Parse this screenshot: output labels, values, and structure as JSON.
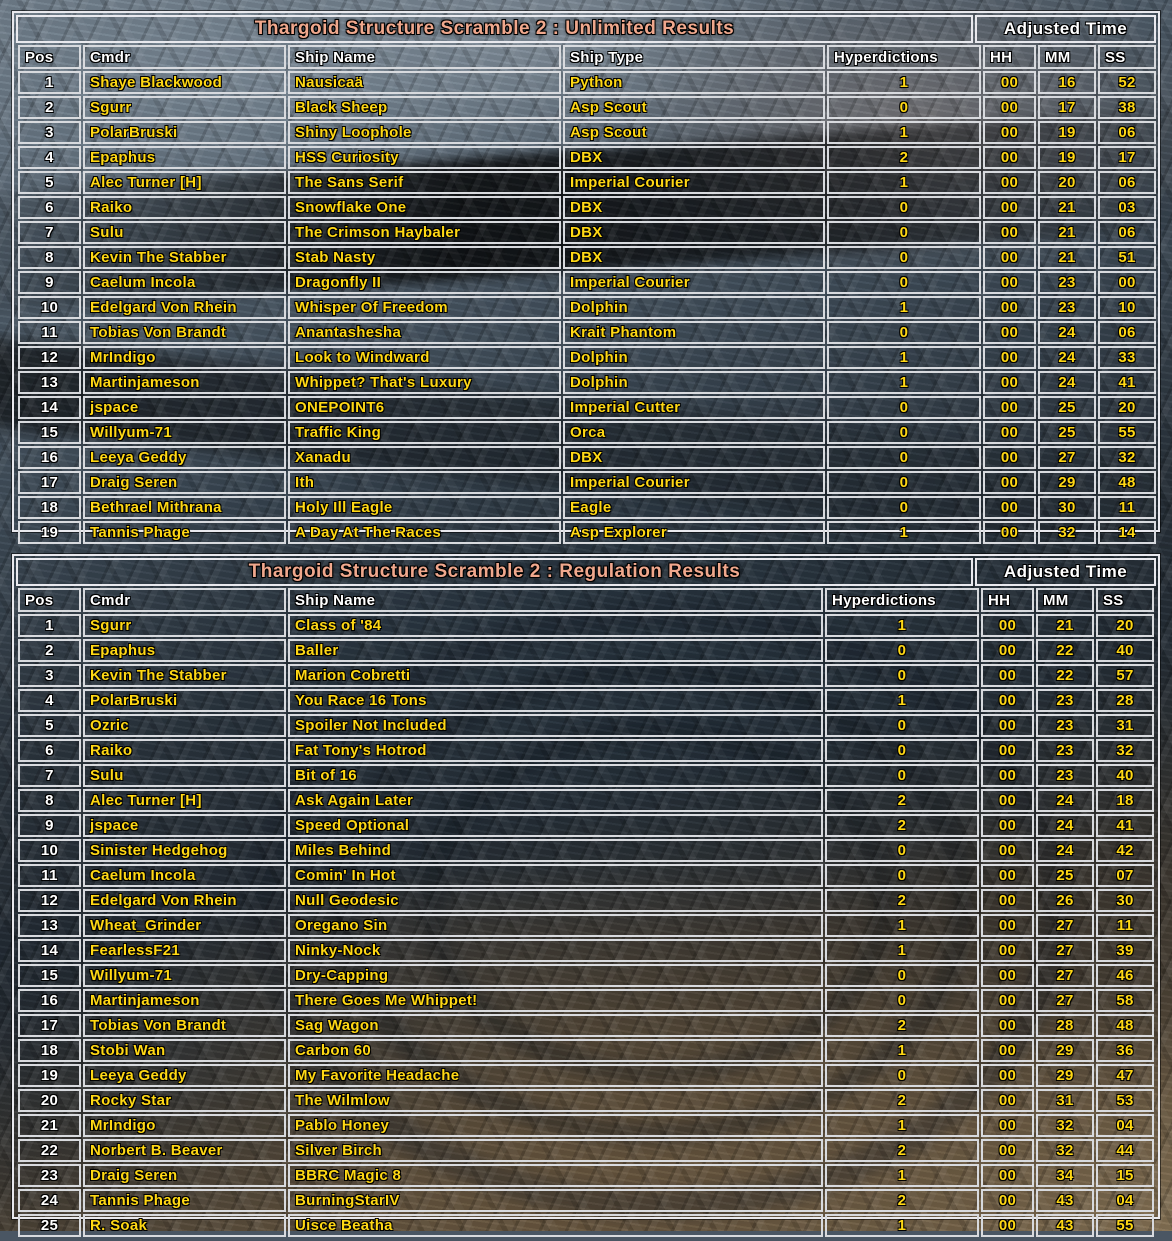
{
  "theme": {
    "title_color": "#f0a88d",
    "header_color": "#ffffff",
    "value_color": "#ffd814",
    "border_color": "#e9e9ee"
  },
  "tables": [
    {
      "id": "unlimited",
      "title": "Thargoid Structure Scramble 2 : Unlimited Results",
      "time_group_label": "Adjusted Time",
      "columns": {
        "pos": "Pos",
        "cmdr": "Cmdr",
        "ship_name": "Ship Name",
        "ship_type": "Ship Type",
        "hyperdictions": "Hyperdictions",
        "hh": "HH",
        "mm": "MM",
        "ss": "SS"
      },
      "has_ship_type": true,
      "rows": [
        {
          "pos": "1",
          "cmdr": "Shaye Blackwood",
          "ship_name": "Nausicaä",
          "ship_type": "Python",
          "hyperdictions": "1",
          "hh": "00",
          "mm": "16",
          "ss": "52"
        },
        {
          "pos": "2",
          "cmdr": "Sgurr",
          "ship_name": "Black Sheep",
          "ship_type": "Asp Scout",
          "hyperdictions": "0",
          "hh": "00",
          "mm": "17",
          "ss": "38"
        },
        {
          "pos": "3",
          "cmdr": "PolarBruski",
          "ship_name": "Shiny Loophole",
          "ship_type": "Asp Scout",
          "hyperdictions": "1",
          "hh": "00",
          "mm": "19",
          "ss": "06"
        },
        {
          "pos": "4",
          "cmdr": "Epaphus",
          "ship_name": "HSS Curiosity",
          "ship_type": "DBX",
          "hyperdictions": "2",
          "hh": "00",
          "mm": "19",
          "ss": "17"
        },
        {
          "pos": "5",
          "cmdr": "Alec Turner [H]",
          "ship_name": "The Sans Serif",
          "ship_type": "Imperial Courier",
          "hyperdictions": "1",
          "hh": "00",
          "mm": "20",
          "ss": "06"
        },
        {
          "pos": "6",
          "cmdr": "Raiko",
          "ship_name": "Snowflake One",
          "ship_type": "DBX",
          "hyperdictions": "0",
          "hh": "00",
          "mm": "21",
          "ss": "03"
        },
        {
          "pos": "7",
          "cmdr": "Sulu",
          "ship_name": "The Crimson Haybaler",
          "ship_type": "DBX",
          "hyperdictions": "0",
          "hh": "00",
          "mm": "21",
          "ss": "06"
        },
        {
          "pos": "8",
          "cmdr": "Kevin The Stabber",
          "ship_name": "Stab Nasty",
          "ship_type": "DBX",
          "hyperdictions": "0",
          "hh": "00",
          "mm": "21",
          "ss": "51"
        },
        {
          "pos": "9",
          "cmdr": "Caelum Incola",
          "ship_name": "Dragonfly II",
          "ship_type": "Imperial Courier",
          "hyperdictions": "0",
          "hh": "00",
          "mm": "23",
          "ss": "00"
        },
        {
          "pos": "10",
          "cmdr": "Edelgard Von Rhein",
          "ship_name": "Whisper Of Freedom",
          "ship_type": "Dolphin",
          "hyperdictions": "1",
          "hh": "00",
          "mm": "23",
          "ss": "10"
        },
        {
          "pos": "11",
          "cmdr": "Tobias Von Brandt",
          "ship_name": "Anantashesha",
          "ship_type": "Krait Phantom",
          "hyperdictions": "0",
          "hh": "00",
          "mm": "24",
          "ss": "06"
        },
        {
          "pos": "12",
          "cmdr": "MrIndigo",
          "ship_name": "Look to Windward",
          "ship_type": "Dolphin",
          "hyperdictions": "1",
          "hh": "00",
          "mm": "24",
          "ss": "33"
        },
        {
          "pos": "13",
          "cmdr": "Martinjameson",
          "ship_name": "Whippet? That's Luxury",
          "ship_type": "Dolphin",
          "hyperdictions": "1",
          "hh": "00",
          "mm": "24",
          "ss": "41"
        },
        {
          "pos": "14",
          "cmdr": "jspace",
          "ship_name": "ONEPOINT6",
          "ship_type": "Imperial Cutter",
          "hyperdictions": "0",
          "hh": "00",
          "mm": "25",
          "ss": "20"
        },
        {
          "pos": "15",
          "cmdr": "Willyum-71",
          "ship_name": "Traffic King",
          "ship_type": "Orca",
          "hyperdictions": "0",
          "hh": "00",
          "mm": "25",
          "ss": "55"
        },
        {
          "pos": "16",
          "cmdr": "Leeya Geddy",
          "ship_name": "Xanadu",
          "ship_type": "DBX",
          "hyperdictions": "0",
          "hh": "00",
          "mm": "27",
          "ss": "32"
        },
        {
          "pos": "17",
          "cmdr": "Draig Seren",
          "ship_name": "Ith",
          "ship_type": "Imperial Courier",
          "hyperdictions": "0",
          "hh": "00",
          "mm": "29",
          "ss": "48"
        },
        {
          "pos": "18",
          "cmdr": "Bethrael Mithrana",
          "ship_name": "Holy Ill Eagle",
          "ship_type": "Eagle",
          "hyperdictions": "0",
          "hh": "00",
          "mm": "30",
          "ss": "11"
        },
        {
          "pos": "19",
          "cmdr": "Tannis Phage",
          "ship_name": "A Day At The Races",
          "ship_type": "Asp Explorer",
          "hyperdictions": "1",
          "hh": "00",
          "mm": "32",
          "ss": "14"
        }
      ]
    },
    {
      "id": "regulation",
      "title": "Thargoid Structure Scramble 2 : Regulation Results",
      "time_group_label": "Adjusted Time",
      "columns": {
        "pos": "Pos",
        "cmdr": "Cmdr",
        "ship_name": "Ship Name",
        "hyperdictions": "Hyperdictions",
        "hh": "HH",
        "mm": "MM",
        "ss": "SS"
      },
      "has_ship_type": false,
      "rows": [
        {
          "pos": "1",
          "cmdr": "Sgurr",
          "ship_name": "Class of '84",
          "hyperdictions": "1",
          "hh": "00",
          "mm": "21",
          "ss": "20"
        },
        {
          "pos": "2",
          "cmdr": "Epaphus",
          "ship_name": "Baller",
          "hyperdictions": "0",
          "hh": "00",
          "mm": "22",
          "ss": "40"
        },
        {
          "pos": "3",
          "cmdr": "Kevin The Stabber",
          "ship_name": "Marion Cobretti",
          "hyperdictions": "0",
          "hh": "00",
          "mm": "22",
          "ss": "57"
        },
        {
          "pos": "4",
          "cmdr": "PolarBruski",
          "ship_name": "You Race 16 Tons",
          "hyperdictions": "1",
          "hh": "00",
          "mm": "23",
          "ss": "28"
        },
        {
          "pos": "5",
          "cmdr": "Ozric",
          "ship_name": "Spoiler Not Included",
          "hyperdictions": "0",
          "hh": "00",
          "mm": "23",
          "ss": "31"
        },
        {
          "pos": "6",
          "cmdr": "Raiko",
          "ship_name": "Fat Tony's Hotrod",
          "hyperdictions": "0",
          "hh": "00",
          "mm": "23",
          "ss": "32"
        },
        {
          "pos": "7",
          "cmdr": "Sulu",
          "ship_name": "Bit of 16",
          "hyperdictions": "0",
          "hh": "00",
          "mm": "23",
          "ss": "40"
        },
        {
          "pos": "8",
          "cmdr": "Alec Turner [H]",
          "ship_name": "Ask Again Later",
          "hyperdictions": "2",
          "hh": "00",
          "mm": "24",
          "ss": "18"
        },
        {
          "pos": "9",
          "cmdr": "jspace",
          "ship_name": "Speed Optional",
          "hyperdictions": "2",
          "hh": "00",
          "mm": "24",
          "ss": "41"
        },
        {
          "pos": "10",
          "cmdr": "Sinister Hedgehog",
          "ship_name": "Miles Behind",
          "hyperdictions": "0",
          "hh": "00",
          "mm": "24",
          "ss": "42"
        },
        {
          "pos": "11",
          "cmdr": "Caelum Incola",
          "ship_name": "Comin' In Hot",
          "hyperdictions": "0",
          "hh": "00",
          "mm": "25",
          "ss": "07"
        },
        {
          "pos": "12",
          "cmdr": "Edelgard Von Rhein",
          "ship_name": "Null Geodesic",
          "hyperdictions": "2",
          "hh": "00",
          "mm": "26",
          "ss": "30"
        },
        {
          "pos": "13",
          "cmdr": "Wheat_Grinder",
          "ship_name": "Oregano Sin",
          "hyperdictions": "1",
          "hh": "00",
          "mm": "27",
          "ss": "11"
        },
        {
          "pos": "14",
          "cmdr": "FearlessF21",
          "ship_name": "Ninky-Nock",
          "hyperdictions": "1",
          "hh": "00",
          "mm": "27",
          "ss": "39"
        },
        {
          "pos": "15",
          "cmdr": "Willyum-71",
          "ship_name": "Dry-Capping",
          "hyperdictions": "0",
          "hh": "00",
          "mm": "27",
          "ss": "46"
        },
        {
          "pos": "16",
          "cmdr": "Martinjameson",
          "ship_name": "There Goes Me Whippet!",
          "hyperdictions": "0",
          "hh": "00",
          "mm": "27",
          "ss": "58"
        },
        {
          "pos": "17",
          "cmdr": "Tobias Von Brandt",
          "ship_name": "Sag Wagon",
          "hyperdictions": "2",
          "hh": "00",
          "mm": "28",
          "ss": "48"
        },
        {
          "pos": "18",
          "cmdr": "Stobi Wan",
          "ship_name": "Carbon 60",
          "hyperdictions": "1",
          "hh": "00",
          "mm": "29",
          "ss": "36"
        },
        {
          "pos": "19",
          "cmdr": "Leeya Geddy",
          "ship_name": "My Favorite Headache",
          "hyperdictions": "0",
          "hh": "00",
          "mm": "29",
          "ss": "47"
        },
        {
          "pos": "20",
          "cmdr": "Rocky Star",
          "ship_name": "The Wilmlow",
          "hyperdictions": "2",
          "hh": "00",
          "mm": "31",
          "ss": "53"
        },
        {
          "pos": "21",
          "cmdr": "MrIndigo",
          "ship_name": "Pablo Honey",
          "hyperdictions": "1",
          "hh": "00",
          "mm": "32",
          "ss": "04"
        },
        {
          "pos": "22",
          "cmdr": "Norbert B. Beaver",
          "ship_name": "Silver Birch",
          "hyperdictions": "2",
          "hh": "00",
          "mm": "32",
          "ss": "44"
        },
        {
          "pos": "23",
          "cmdr": "Draig Seren",
          "ship_name": "BBRC Magic 8",
          "hyperdictions": "1",
          "hh": "00",
          "mm": "34",
          "ss": "15"
        },
        {
          "pos": "24",
          "cmdr": "Tannis Phage",
          "ship_name": "BurningStarIV",
          "hyperdictions": "2",
          "hh": "00",
          "mm": "43",
          "ss": "04"
        },
        {
          "pos": "25",
          "cmdr": "R. Soak",
          "ship_name": "Uisce Beatha",
          "hyperdictions": "1",
          "hh": "00",
          "mm": "43",
          "ss": "55"
        }
      ]
    }
  ]
}
